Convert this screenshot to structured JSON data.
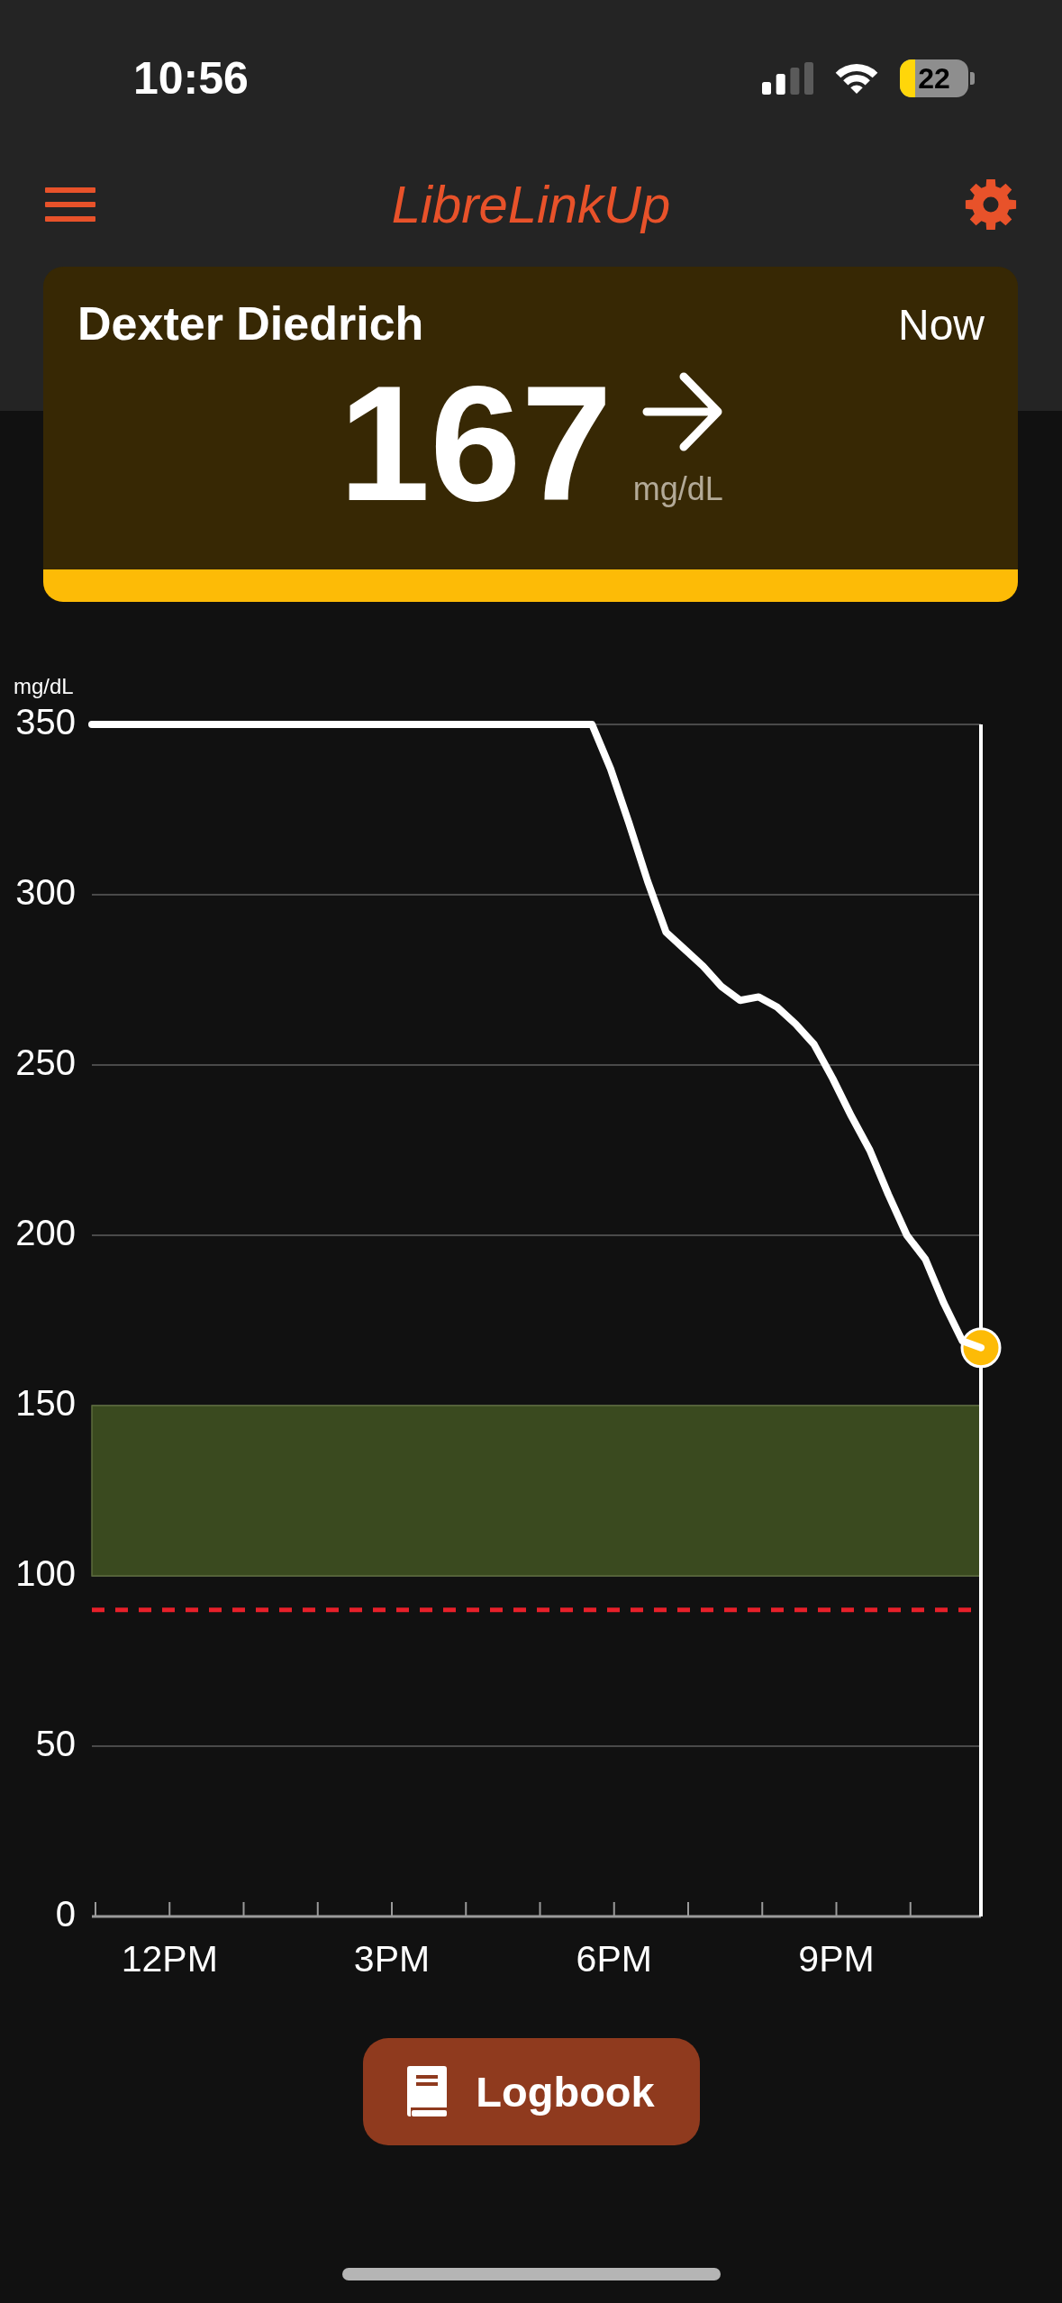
{
  "status_bar": {
    "time": "10:56",
    "battery": "22",
    "low_power": true
  },
  "app_bar": {
    "title": "LibreLinkUp"
  },
  "reading_card": {
    "patient_name": "Dexter Diedrich",
    "updated": "Now",
    "value": "167",
    "unit": "mg/dL",
    "above_target": true
  },
  "chart": {
    "chart_data": {
      "type": "line",
      "ylabel": "mg/dL",
      "grid": true,
      "categories": [
        null,
        null,
        null,
        null,
        "12PM",
        null,
        null,
        null,
        null,
        null,
        null,
        null,
        null,
        null,
        null,
        null,
        "3PM",
        null,
        null,
        null,
        null,
        null,
        null,
        null,
        null,
        null,
        null,
        null,
        "6PM",
        null,
        null,
        null,
        null,
        null,
        null,
        null,
        null,
        null,
        null,
        null,
        "9PM",
        null,
        null,
        null,
        null,
        null,
        null,
        null,
        null
      ],
      "values": [
        350,
        350,
        350,
        350,
        350,
        350,
        350,
        350,
        350,
        350,
        350,
        350,
        350,
        350,
        350,
        350,
        350,
        350,
        350,
        350,
        350,
        350,
        350,
        350,
        350,
        350,
        350,
        350,
        337,
        321,
        304,
        289,
        284,
        279,
        273,
        269,
        270,
        267,
        262,
        256,
        246,
        235,
        225,
        212,
        200,
        193,
        180,
        169,
        167
      ],
      "ylim": [
        0,
        350
      ],
      "yticks": [
        0,
        50,
        100,
        150,
        200,
        250,
        300,
        350
      ],
      "bands": [
        {
          "axis": "y",
          "from": 100,
          "to": 150
        }
      ],
      "ref_lines": [
        {
          "axis": "y",
          "value": 90
        }
      ]
    }
  },
  "logbook_button": {
    "label": "Logbook"
  }
}
